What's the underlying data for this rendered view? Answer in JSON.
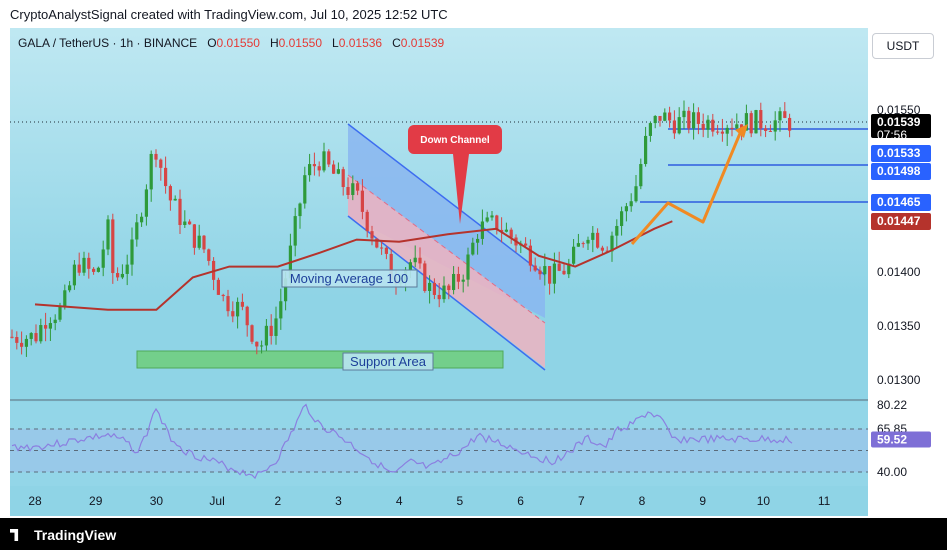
{
  "header": {
    "credit": "CryptoAnalystSignal created with TradingView.com, Jul 10, 2025 12:52 UTC"
  },
  "symbol": {
    "name": "GALA / TetherUS · 1h · BINANCE",
    "o_label": "O",
    "o": "0.01550",
    "h_label": "H",
    "h": "0.01550",
    "l_label": "L",
    "l": "0.01536",
    "c_label": "C",
    "c": "0.01539"
  },
  "currency_button": "USDT",
  "footer": {
    "brand": "TradingView"
  },
  "colors": {
    "up": "#26a69a",
    "down": "#ef5350",
    "candle_up": "#2e9a3a",
    "candle_down": "#d64545",
    "ma": "#b5332c",
    "channel": "#3d6df0",
    "arrow": "#f08a24",
    "rsi": "#8b7fe0",
    "support": "#6fce7a"
  },
  "chart_data": {
    "type": "candlestick",
    "timeframe": "1h",
    "x_labels": [
      "28",
      "29",
      "30",
      "Jul",
      "2",
      "3",
      "4",
      "5",
      "6",
      "7",
      "8",
      "9",
      "10",
      "11"
    ],
    "y_ticks": [
      "0.01300",
      "0.01350",
      "0.01400",
      "0.01550"
    ],
    "ylim": [
      0.01285,
      0.0158
    ],
    "price_tags": [
      {
        "value": "0.01539",
        "sub": "07:56",
        "style": "last"
      },
      {
        "value": "0.01533",
        "style": "level"
      },
      {
        "value": "0.01498",
        "style": "level"
      },
      {
        "value": "0.01465",
        "style": "level"
      },
      {
        "value": "0.01447",
        "style": "ma"
      }
    ],
    "close_path": [
      [
        0.0,
        0.0134
      ],
      [
        0.2,
        0.0136
      ],
      [
        0.45,
        0.01365
      ],
      [
        0.7,
        0.0141
      ],
      [
        1.0,
        0.01395
      ],
      [
        1.2,
        0.0144
      ],
      [
        1.3,
        0.0139
      ],
      [
        1.6,
        0.0142
      ],
      [
        1.9,
        0.015
      ],
      [
        1.97,
        0.0152
      ],
      [
        2.2,
        0.0147
      ],
      [
        2.5,
        0.0144
      ],
      [
        2.8,
        0.0142
      ],
      [
        3.1,
        0.01375
      ],
      [
        3.4,
        0.01365
      ],
      [
        3.7,
        0.0133
      ],
      [
        4.0,
        0.0136
      ],
      [
        4.25,
        0.0143
      ],
      [
        4.45,
        0.0149
      ],
      [
        4.7,
        0.01505
      ],
      [
        5.0,
        0.01485
      ],
      [
        5.3,
        0.0147
      ],
      [
        5.6,
        0.0143
      ],
      [
        5.9,
        0.01395
      ],
      [
        6.2,
        0.0141
      ],
      [
        6.5,
        0.01385
      ],
      [
        6.8,
        0.0138
      ],
      [
        7.1,
        0.01405
      ],
      [
        7.3,
        0.0144
      ],
      [
        7.6,
        0.01445
      ],
      [
        7.9,
        0.0143
      ],
      [
        8.2,
        0.01415
      ],
      [
        8.5,
        0.01395
      ],
      [
        8.8,
        0.01405
      ],
      [
        9.1,
        0.0144
      ],
      [
        9.4,
        0.01425
      ],
      [
        9.6,
        0.01445
      ],
      [
        9.9,
        0.0148
      ],
      [
        10.1,
        0.0153
      ],
      [
        10.3,
        0.01545
      ],
      [
        10.5,
        0.01539
      ]
    ],
    "ma_path": [
      [
        0.0,
        0.0137
      ],
      [
        1.2,
        0.01365
      ],
      [
        2.0,
        0.01365
      ],
      [
        2.6,
        0.01395
      ],
      [
        3.2,
        0.01405
      ],
      [
        4.0,
        0.01405
      ],
      [
        4.7,
        0.01418
      ],
      [
        5.3,
        0.0143
      ],
      [
        6.0,
        0.01428
      ],
      [
        6.8,
        0.01435
      ],
      [
        7.6,
        0.0144
      ],
      [
        8.3,
        0.01415
      ],
      [
        8.9,
        0.01405
      ],
      [
        9.5,
        0.0142
      ],
      [
        10.2,
        0.0144
      ],
      [
        10.5,
        0.01447
      ]
    ],
    "rsi": {
      "ticks": [
        "80.22",
        "65.85",
        "40.00"
      ],
      "current": "59.52",
      "path": [
        [
          0.0,
          55
        ],
        [
          0.4,
          57
        ],
        [
          0.8,
          60
        ],
        [
          1.2,
          62
        ],
        [
          1.5,
          58
        ],
        [
          1.7,
          52
        ],
        [
          1.9,
          68
        ],
        [
          1.97,
          80
        ],
        [
          2.2,
          62
        ],
        [
          2.5,
          52
        ],
        [
          2.8,
          48
        ],
        [
          3.1,
          44
        ],
        [
          3.4,
          40
        ],
        [
          3.7,
          38
        ],
        [
          4.0,
          48
        ],
        [
          4.25,
          65
        ],
        [
          4.45,
          80
        ],
        [
          4.7,
          68
        ],
        [
          5.0,
          62
        ],
        [
          5.3,
          54
        ],
        [
          5.6,
          46
        ],
        [
          5.9,
          38
        ],
        [
          6.2,
          46
        ],
        [
          6.5,
          42
        ],
        [
          6.8,
          48
        ],
        [
          7.1,
          55
        ],
        [
          7.3,
          62
        ],
        [
          7.6,
          58
        ],
        [
          7.9,
          54
        ],
        [
          8.2,
          50
        ],
        [
          8.5,
          46
        ],
        [
          8.8,
          52
        ],
        [
          9.1,
          60
        ],
        [
          9.4,
          55
        ],
        [
          9.6,
          65
        ],
        [
          9.9,
          70
        ],
        [
          10.1,
          76
        ],
        [
          10.3,
          72
        ],
        [
          10.5,
          59.52
        ]
      ]
    },
    "annotations": [
      {
        "text": "Down Channel",
        "type": "callout"
      },
      {
        "text": "Moving Average 100",
        "type": "label"
      },
      {
        "text": "Support Area",
        "type": "zone"
      }
    ]
  }
}
